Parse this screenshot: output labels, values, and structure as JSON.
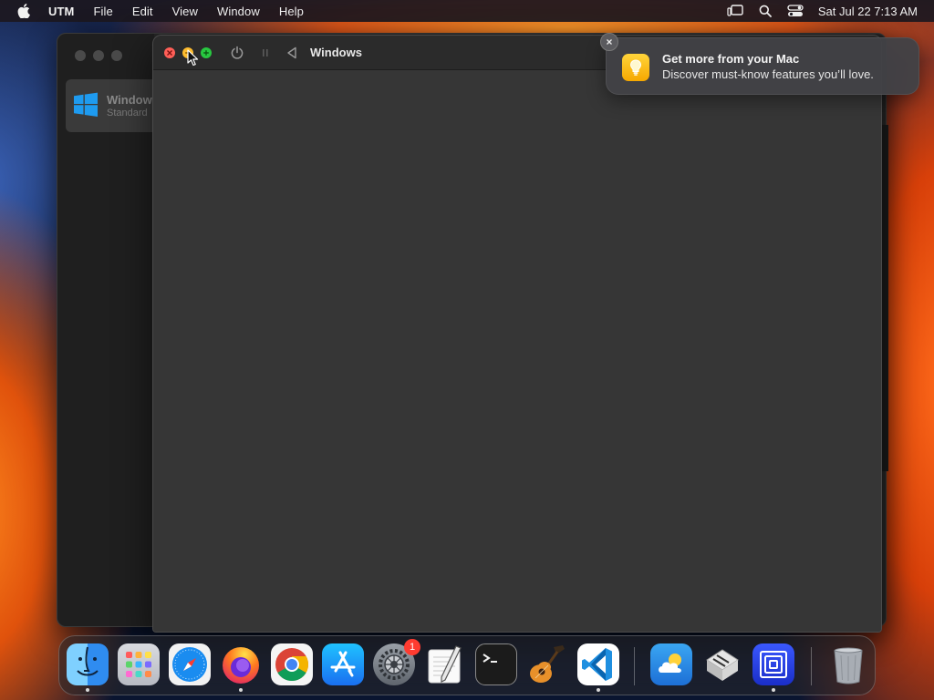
{
  "menubar": {
    "app_name": "UTM",
    "items": [
      "File",
      "Edit",
      "View",
      "Window",
      "Help"
    ],
    "clock": "Sat Jul 22  7:13 AM"
  },
  "library": {
    "vm_name": "Windows",
    "vm_subtitle": "Standard"
  },
  "vm_window": {
    "title": "Windows"
  },
  "notification": {
    "title": "Get more from your Mac",
    "body": "Discover must-know features you’ll love."
  },
  "dock": {
    "settings_badge": "1"
  }
}
